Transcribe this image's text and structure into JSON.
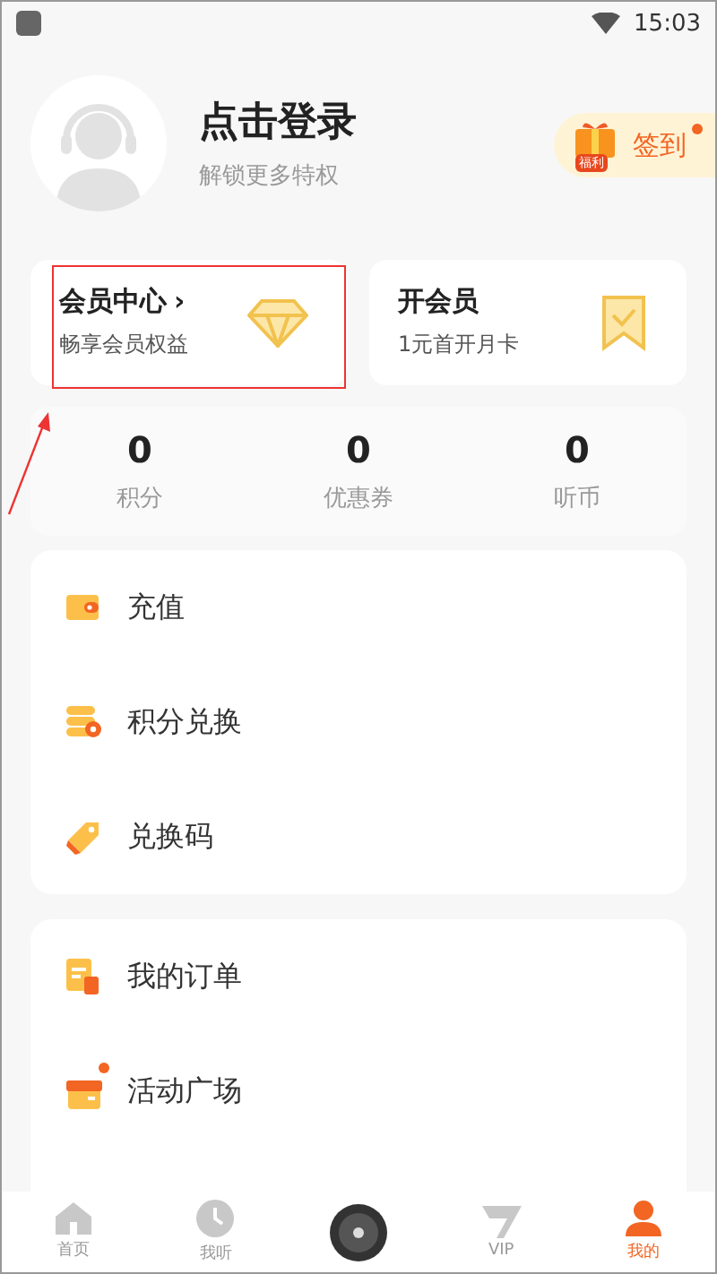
{
  "status_bar": {
    "time": "15:03"
  },
  "profile": {
    "title": "点击登录",
    "subtitle": "解锁更多特权"
  },
  "checkin": {
    "badge": "福利",
    "label": "签到",
    "unread": true
  },
  "member_cards": [
    {
      "kind": "diamond",
      "title": "会员中心",
      "chevron": "›",
      "subtitle": "畅享会员权益"
    },
    {
      "kind": "bookmark",
      "title": "开会员",
      "subtitle": "1元首开月卡"
    }
  ],
  "stats": [
    {
      "value": "0",
      "label": "积分"
    },
    {
      "value": "0",
      "label": "优惠券"
    },
    {
      "value": "0",
      "label": "听币"
    }
  ],
  "menu_groups": [
    [
      {
        "kind": "wallet",
        "label": "充值",
        "dot": false
      },
      {
        "kind": "coins",
        "label": "积分兑换",
        "dot": false
      },
      {
        "kind": "tag",
        "label": "兑换码",
        "dot": false
      }
    ],
    [
      {
        "kind": "order",
        "label": "我的订单",
        "dot": false
      },
      {
        "kind": "gift",
        "label": "活动广场",
        "dot": true
      }
    ]
  ],
  "tab_bar": [
    {
      "kind": "home",
      "label": "首页",
      "selected": false
    },
    {
      "kind": "clock",
      "label": "我听",
      "selected": false
    },
    {
      "kind": "disc",
      "selected": false
    },
    {
      "kind": "vip",
      "label": "VIP",
      "selected": false
    },
    {
      "kind": "person",
      "label": "我的",
      "selected": true
    }
  ]
}
